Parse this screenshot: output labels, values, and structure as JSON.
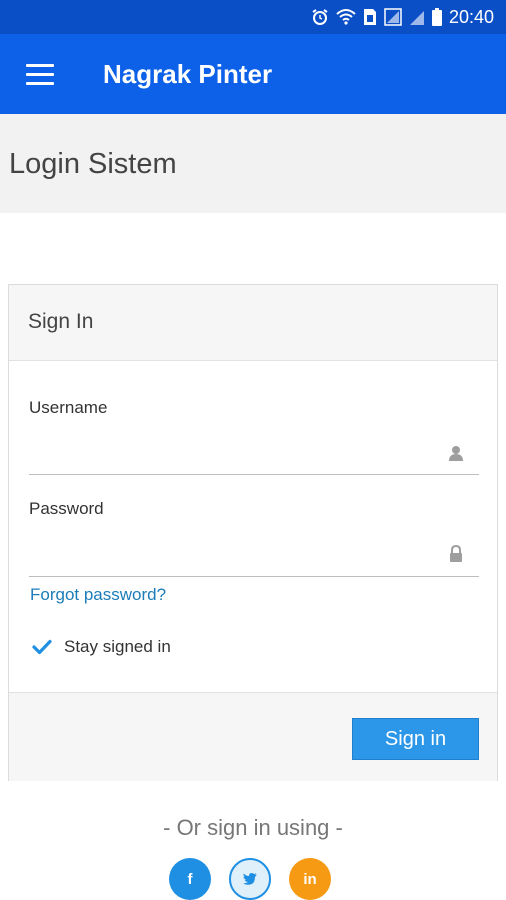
{
  "status_bar": {
    "time": "20:40"
  },
  "app_bar": {
    "title": "Nagrak Pinter"
  },
  "page": {
    "title": "Login Sistem"
  },
  "signin_card": {
    "title": "Sign In",
    "username": {
      "label": "Username",
      "value": "",
      "icon": "user-icon"
    },
    "password": {
      "label": "Password",
      "value": "",
      "icon": "lock-icon"
    },
    "forgot_password": "Forgot password?",
    "stay_signed_in": {
      "label": "Stay signed in",
      "checked": true
    },
    "submit_label": "Sign in"
  },
  "alternative": {
    "text": "- Or sign in using -",
    "providers": [
      {
        "name": "facebook",
        "glyph": "f",
        "color": "#1f8fe3"
      },
      {
        "name": "twitter",
        "glyph": "t",
        "color": "#1f8fe3"
      },
      {
        "name": "linkedin",
        "glyph": "in",
        "color": "#f59a12"
      }
    ]
  },
  "colors": {
    "status_bar": "#0b4fc7",
    "app_bar": "#0c61e8",
    "button": "#2c97e8",
    "link": "#1d7cb8"
  }
}
